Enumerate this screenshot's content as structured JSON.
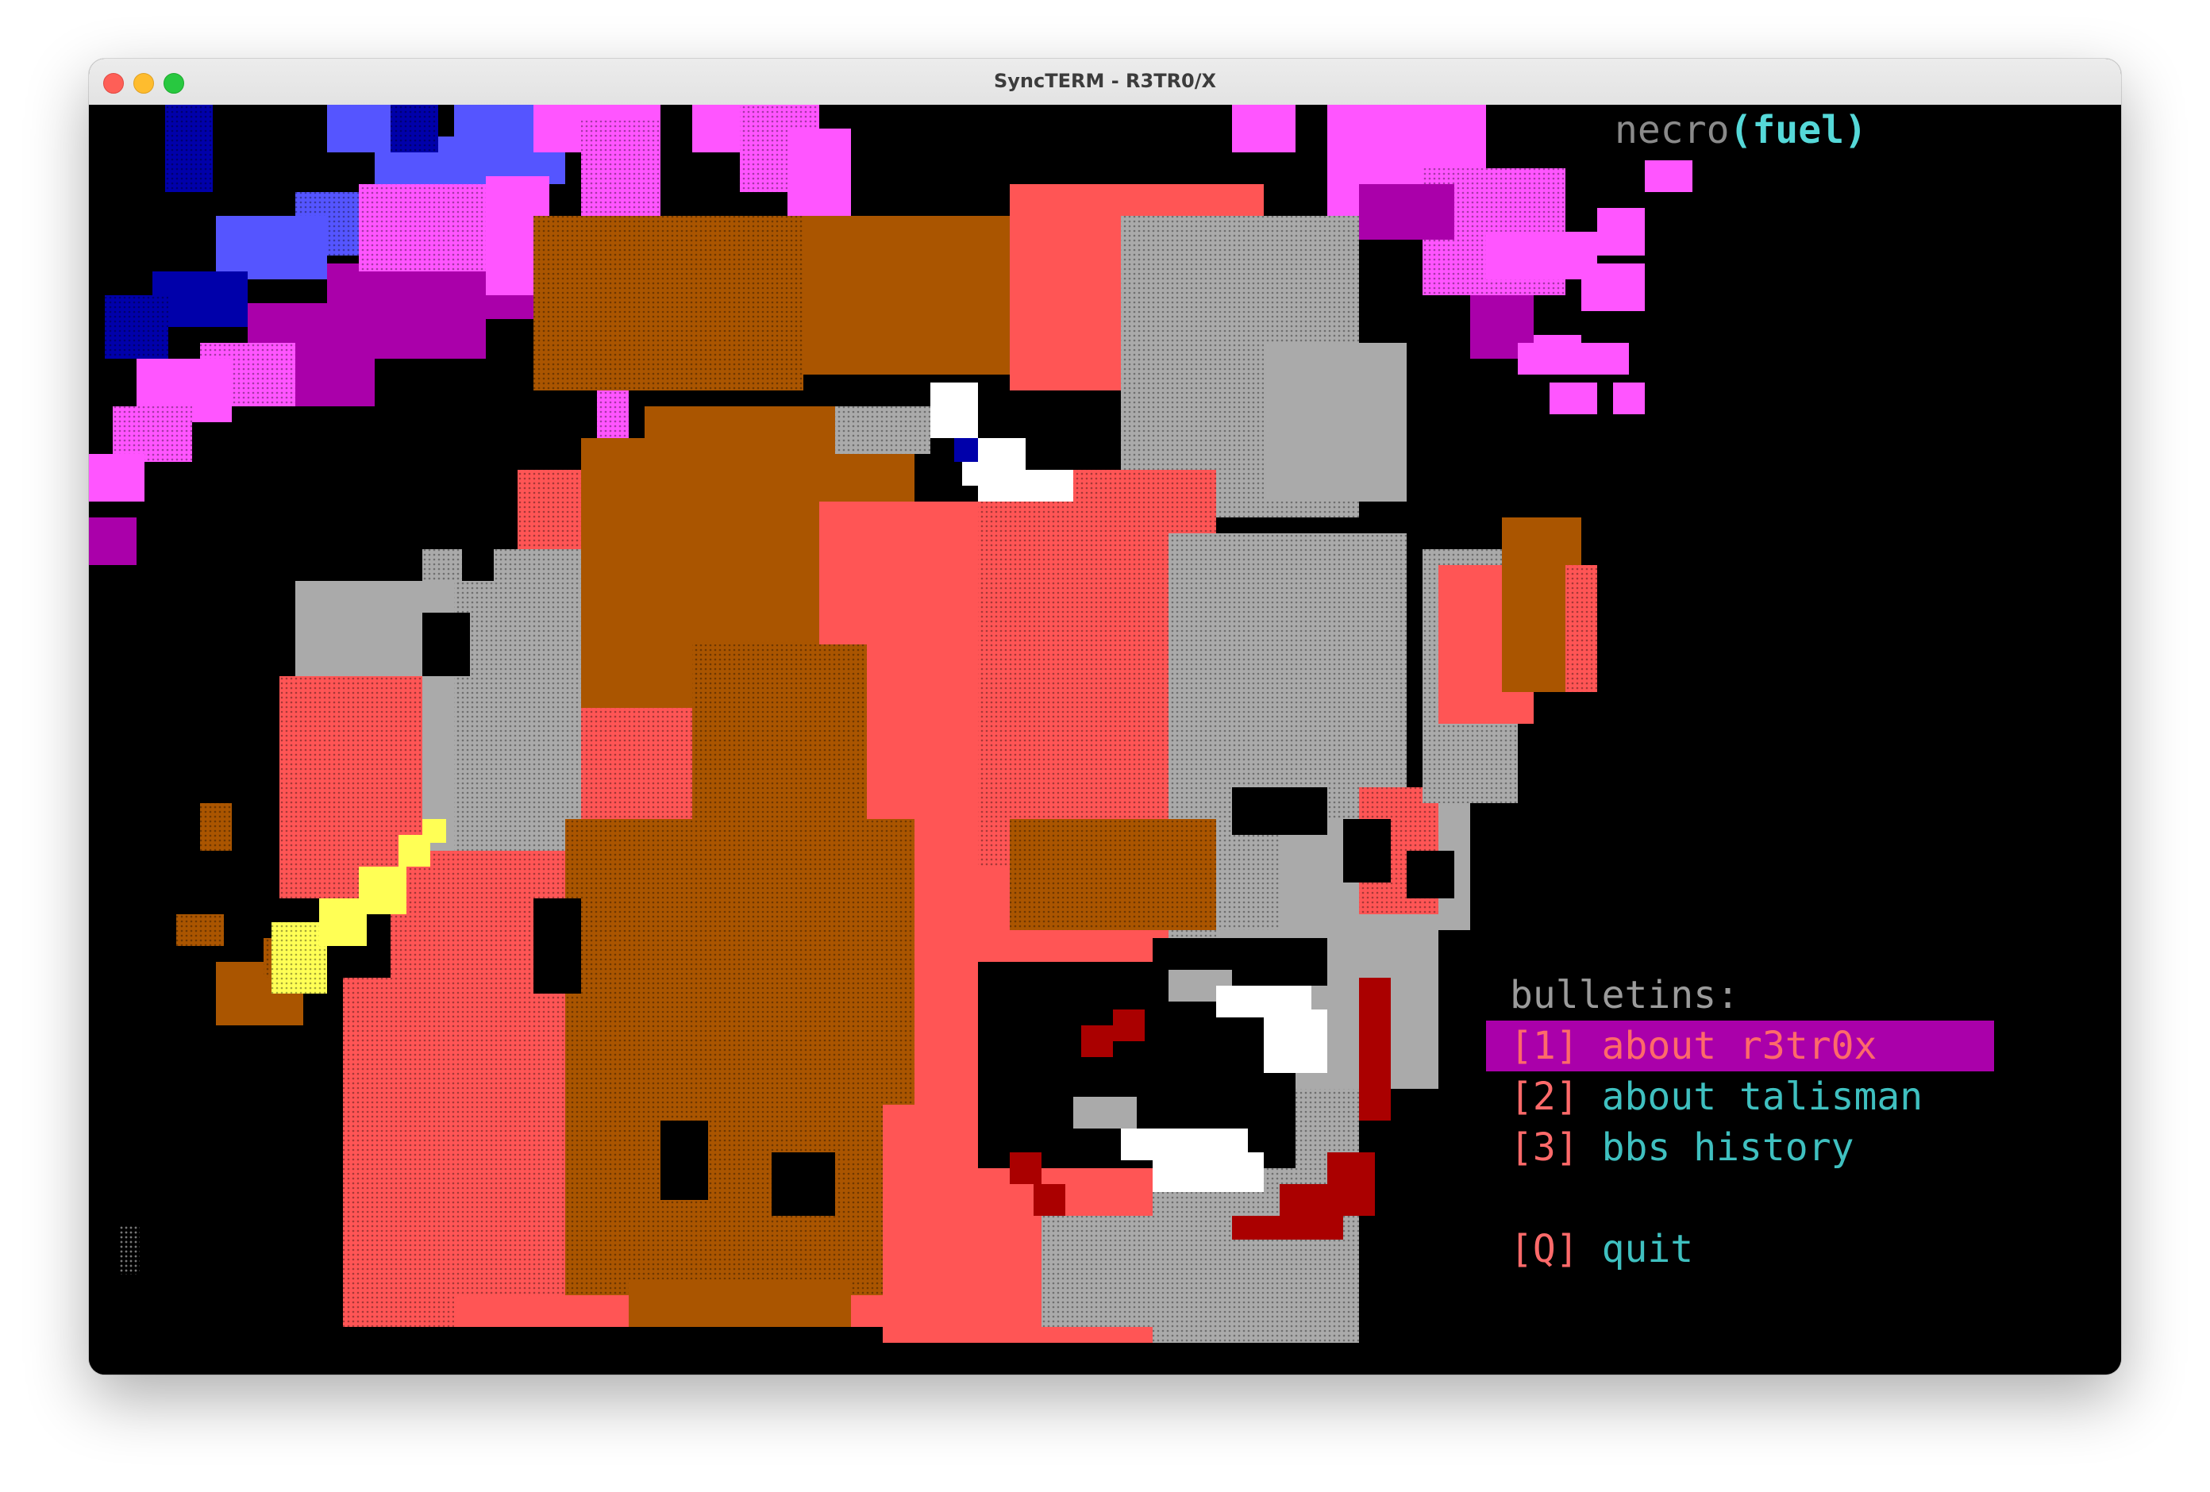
{
  "window": {
    "title": "SyncTERM - R3TR0/X"
  },
  "signature": {
    "prefix": "necro",
    "suffix": "(fuel)"
  },
  "menu": {
    "heading": "bulletins:",
    "items": [
      {
        "key": "[1]",
        "label": "about r3tr0x",
        "selected": true
      },
      {
        "key": "[2]",
        "label": "about talisman",
        "selected": false
      },
      {
        "key": "[3]",
        "label": "bbs history",
        "selected": false
      },
      {
        "key": "[Q]",
        "label": "quit",
        "selected": false
      }
    ]
  },
  "artwork": {
    "description_icon": "ansi-portrait-art",
    "palette": {
      "blue": "#5555ff",
      "dark_blue": "#0000aa",
      "magenta": "#ff55ff",
      "purple": "#aa00aa",
      "brown": "#aa5500",
      "red": "#ff5555",
      "dark_red": "#aa0000",
      "gray": "#aaaaaa",
      "white": "#ffffff",
      "yellow": "#ffff55"
    }
  }
}
